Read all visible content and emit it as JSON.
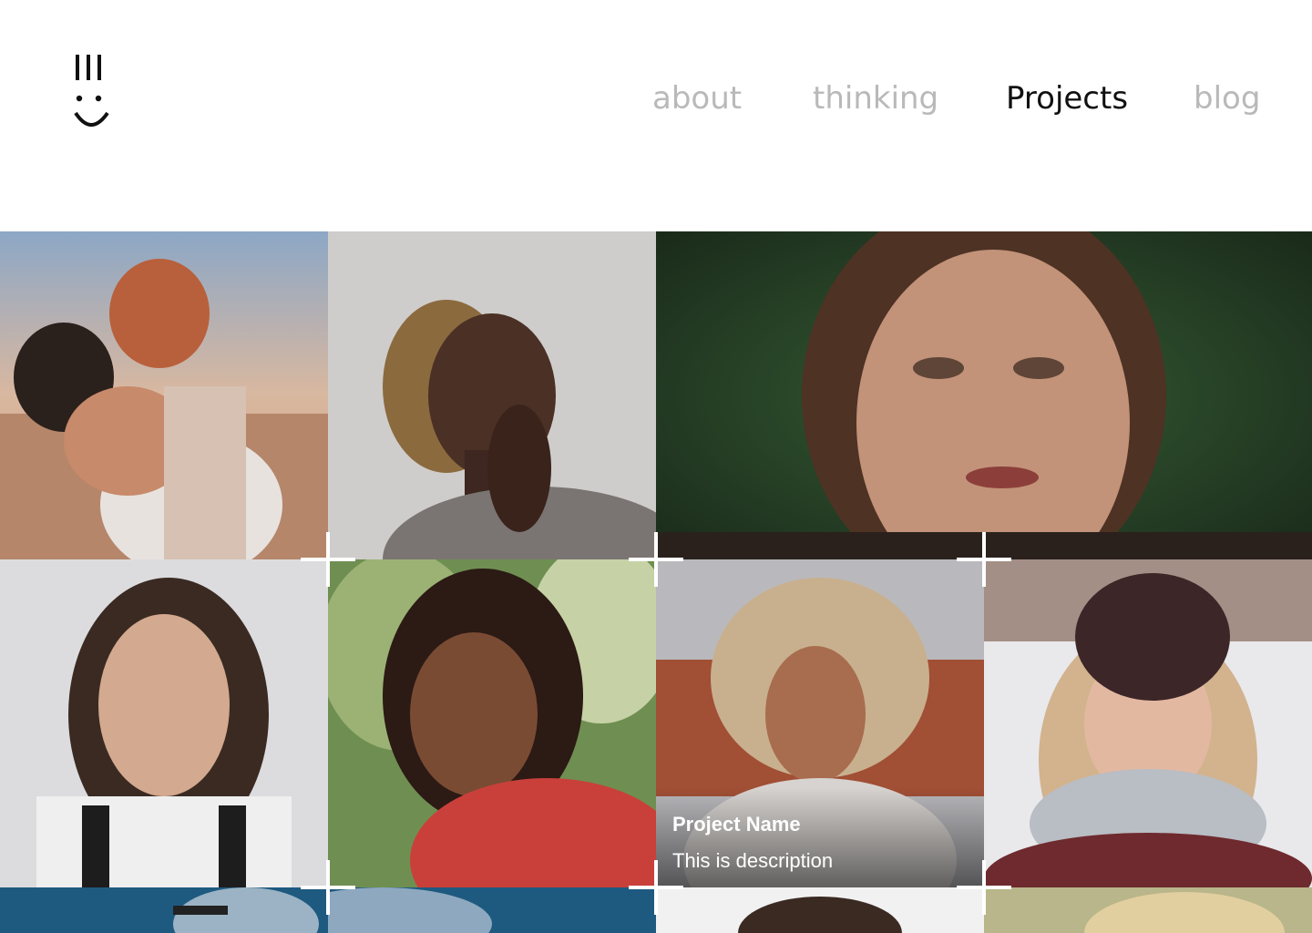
{
  "nav": {
    "items": [
      {
        "label": "about",
        "active": false
      },
      {
        "label": "thinking",
        "active": false
      },
      {
        "label": "Projects",
        "active": true
      },
      {
        "label": "blog",
        "active": false
      }
    ]
  },
  "logo": {
    "icon": "smiley-logo-icon"
  },
  "gallery": {
    "hover_project": {
      "name": "Project Name",
      "description": "This is description"
    }
  },
  "colors": {
    "nav_inactive": "#b9b9b9",
    "nav_active": "#111111",
    "background": "#ffffff"
  }
}
